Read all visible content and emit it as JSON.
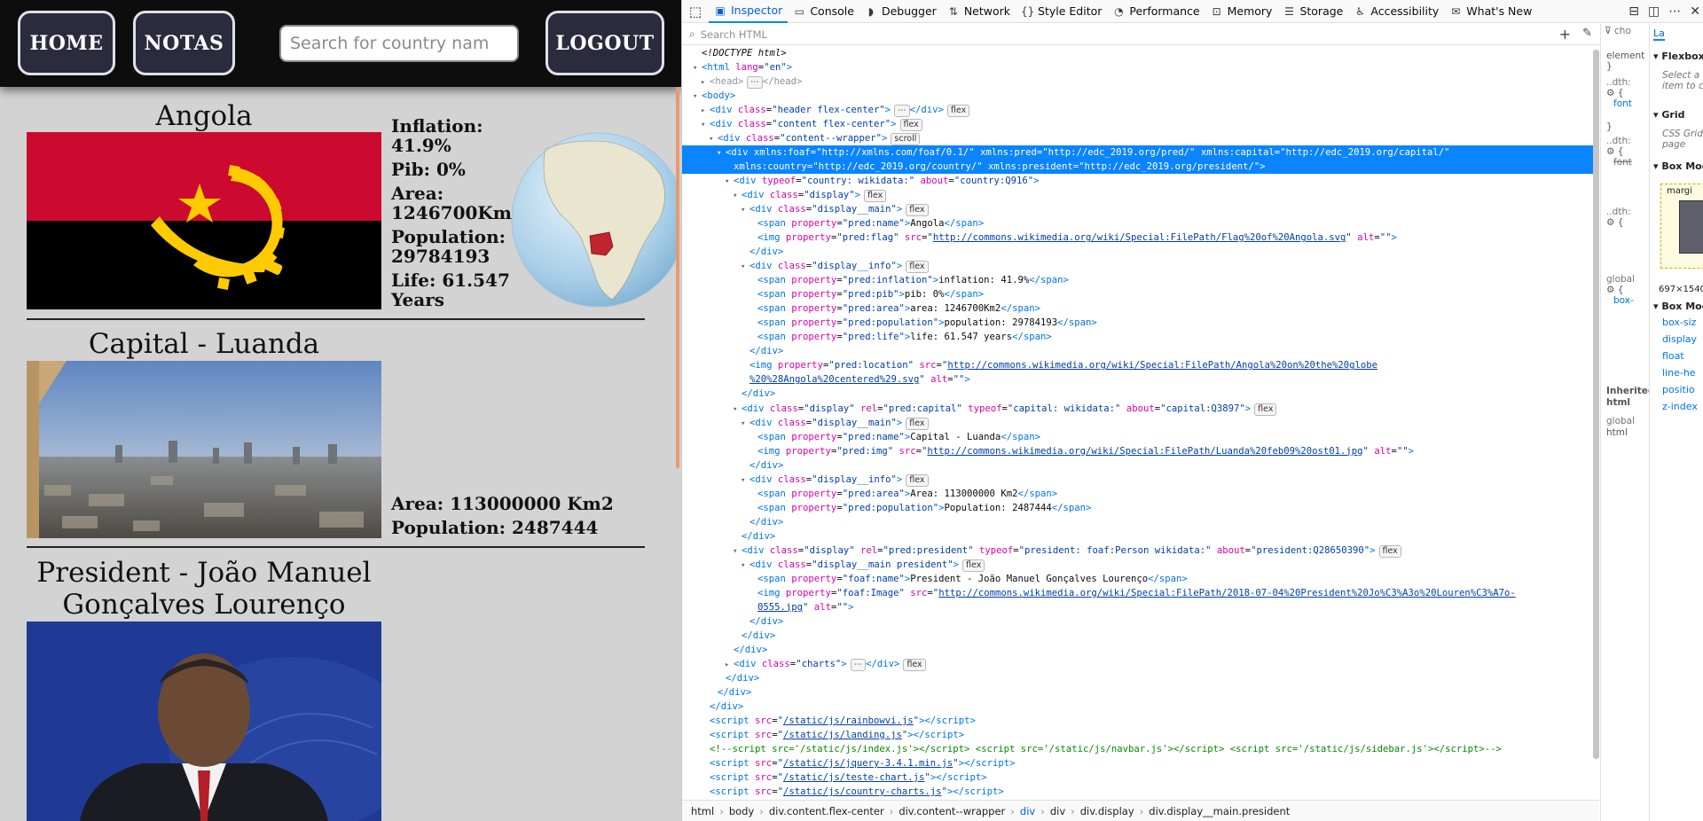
{
  "site": {
    "nav": {
      "home": "HOME",
      "notas": "NOTAS",
      "logout": "LOGOUT",
      "search_placeholder": "Search for country nam"
    },
    "country": {
      "name": "Angola",
      "inflation": "Inflation:",
      "inflation_value": "41.9%",
      "pib": "Pib: 0%",
      "area": "Area:",
      "area_value": "1246700Km2",
      "population": "Population:",
      "population_value": "29784193",
      "life": "Life: 61.547",
      "life_unit": "Years"
    },
    "capital": {
      "name": "Capital - Luanda",
      "area": "Area: 113000000 Km2",
      "population": "Population: 2487444"
    },
    "president": {
      "name_line1": "President - João Manuel",
      "name_line2": "Gonçalves Lourenço"
    }
  },
  "devtools": {
    "tabs": [
      {
        "label": "Inspector",
        "icon": "inspector-icon"
      },
      {
        "label": "Console",
        "icon": "console-icon"
      },
      {
        "label": "Debugger",
        "icon": "debugger-icon"
      },
      {
        "label": "Network",
        "icon": "network-icon"
      },
      {
        "label": "Style Editor",
        "icon": "style-editor-icon"
      },
      {
        "label": "Performance",
        "icon": "performance-icon"
      },
      {
        "label": "Memory",
        "icon": "memory-icon"
      },
      {
        "label": "Storage",
        "icon": "storage-icon"
      },
      {
        "label": "Accessibility",
        "icon": "accessibility-icon"
      },
      {
        "label": "What's New",
        "icon": "whats-new-icon"
      }
    ],
    "search_placeholder": "Search HTML",
    "breadcrumbs": [
      "html",
      "body",
      "div.content.flex-center",
      "div.content--wrapper",
      "div",
      "div",
      "div.display",
      "div.display__main.president"
    ],
    "rules_panel": {
      "filter_text": "cho",
      "element_label": "element",
      "brace": "}",
      "dth_label": "..dth:",
      "font_label": "font",
      "global_label": "global",
      "box_label": "box-",
      "inherited": "Inherited",
      "inherited_from": "html",
      "html_label": "html"
    },
    "layout_panel": {
      "tab": "La",
      "flexbox": "Flexbox",
      "flexbox_hint": "Select a",
      "flexbox_hint2": "item to c",
      "grid": "Grid",
      "grid_hint": "CSS Grid",
      "grid_hint2": "page",
      "box_model": "Box Moc",
      "margin": "margi",
      "dims": "697×1540",
      "box_model_props": "Box Moc",
      "props": [
        "box-siz",
        "display",
        "float",
        "line-he",
        "positio",
        "z-index"
      ]
    },
    "code_lines": [
      {
        "indent": 0,
        "html": "<span class=\"cm\" style=\"color:#0c0c0d;font-style:italic\">&lt;!DOCTYPE html&gt;</span>"
      },
      {
        "indent": 0,
        "arrow": "▾",
        "html": "<span class=\"tg\">&lt;html</span> <span class=\"at\">lang</span>=<span class=\"av\">\"en\"</span><span class=\"tg\">&gt;</span>"
      },
      {
        "indent": 1,
        "arrow": "▸",
        "html": "<span class=\"tg\" style=\"color:#8f8f9d\">&lt;head&gt;</span><span class=\"badge\">⋯</span><span class=\"tg\" style=\"color:#8f8f9d\">&lt;/head&gt;</span>"
      },
      {
        "indent": 0,
        "arrow": "▾",
        "html": "<span class=\"tg\">&lt;body&gt;</span>"
      },
      {
        "indent": 1,
        "arrow": "▸",
        "html": "<span class=\"tg\">&lt;div</span> <span class=\"at\">class</span>=<span class=\"av\">\"header flex-center\"</span><span class=\"tg\">&gt;</span><span class=\"badge\">⋯</span><span class=\"tg\">&lt;/div&gt;</span><span class=\"badge\">flex</span>"
      },
      {
        "indent": 1,
        "arrow": "▾",
        "html": "<span class=\"tg\">&lt;div</span> <span class=\"at\">class</span>=<span class=\"av\">\"content flex-center\"</span><span class=\"tg\">&gt;</span><span class=\"badge\">flex</span>"
      },
      {
        "indent": 2,
        "arrow": "▾",
        "html": "<span class=\"tg\">&lt;div</span> <span class=\"at\">class</span>=<span class=\"av\">\"content--wrapper\"</span><span class=\"tg\">&gt;</span><span class=\"badge\">scroll</span>"
      },
      {
        "indent": 3,
        "arrow": "▾",
        "selected": true,
        "html": "<span class=\"tg\">&lt;div</span> <span class=\"at\">xmlns:foaf</span>=<span class=\"av\">\"http://xmlns.com/foaf/0.1/\"</span> <span class=\"at\">xmlns:pred</span>=<span class=\"av\">\"http://edc_2019.org/pred/\"</span> <span class=\"at\">xmlns:capital</span>=<span class=\"av\">\"http://edc_2019.org/capital/\"</span>"
      },
      {
        "indent": 4,
        "selected": true,
        "html": "<span class=\"at\">xmlns:country</span>=<span class=\"av\">\"http://edc_2019.org/country/\"</span> <span class=\"at\">xmlns:president</span>=<span class=\"av\">\"http://edc_2019.org/president/\"</span><span class=\"tg\">&gt;</span>"
      },
      {
        "indent": 4,
        "arrow": "▾",
        "html": "<span class=\"tg\">&lt;div</span> <span class=\"at\">typeof</span>=<span class=\"av\">\"country: wikidata:\"</span> <span class=\"at\">about</span>=<span class=\"av\">\"country:Q916\"</span><span class=\"tg\">&gt;</span>"
      },
      {
        "indent": 5,
        "arrow": "▾",
        "html": "<span class=\"tg\">&lt;div</span> <span class=\"at\">class</span>=<span class=\"av\">\"display\"</span><span class=\"tg\">&gt;</span><span class=\"badge\">flex</span>"
      },
      {
        "indent": 6,
        "arrow": "▾",
        "html": "<span class=\"tg\">&lt;div</span> <span class=\"at\">class</span>=<span class=\"av\">\"display__main\"</span><span class=\"tg\">&gt;</span><span class=\"badge\">flex</span>"
      },
      {
        "indent": 7,
        "html": "<span class=\"tg\">&lt;span</span> <span class=\"at\">property</span>=<span class=\"av\">\"pred:name\"</span><span class=\"tg\">&gt;</span>Angola<span class=\"tg\">&lt;/span&gt;</span>"
      },
      {
        "indent": 7,
        "html": "<span class=\"tg\">&lt;img</span> <span class=\"at\">property</span>=<span class=\"av\">\"pred:flag\"</span> <span class=\"at\">src</span>=<span class=\"av\">\"</span><span class=\"lk\">http://commons.wikimedia.org/wiki/Special:FilePath/Flag%20of%20Angola.svg</span><span class=\"av\">\"</span> <span class=\"at\">alt</span>=<span class=\"av\">\"\"</span><span class=\"tg\">&gt;</span>"
      },
      {
        "indent": 6,
        "html": "<span class=\"tg\">&lt;/div&gt;</span>"
      },
      {
        "indent": 6,
        "arrow": "▾",
        "html": "<span class=\"tg\">&lt;div</span> <span class=\"at\">class</span>=<span class=\"av\">\"display__info\"</span><span class=\"tg\">&gt;</span><span class=\"badge\">flex</span>"
      },
      {
        "indent": 7,
        "html": "<span class=\"tg\">&lt;span</span> <span class=\"at\">property</span>=<span class=\"av\">\"pred:inflation\"</span><span class=\"tg\">&gt;</span>inflation: 41.9%<span class=\"tg\">&lt;/span&gt;</span>"
      },
      {
        "indent": 7,
        "html": "<span class=\"tg\">&lt;span</span> <span class=\"at\">property</span>=<span class=\"av\">\"pred:pib\"</span><span class=\"tg\">&gt;</span>pib: 0%<span class=\"tg\">&lt;/span&gt;</span>"
      },
      {
        "indent": 7,
        "html": "<span class=\"tg\">&lt;span</span> <span class=\"at\">property</span>=<span class=\"av\">\"pred:area\"</span><span class=\"tg\">&gt;</span>area: 1246700Km2<span class=\"tg\">&lt;/span&gt;</span>"
      },
      {
        "indent": 7,
        "html": "<span class=\"tg\">&lt;span</span> <span class=\"at\">property</span>=<span class=\"av\">\"pred:population\"</span><span class=\"tg\">&gt;</span>population: 29784193<span class=\"tg\">&lt;/span&gt;</span>"
      },
      {
        "indent": 7,
        "html": "<span class=\"tg\">&lt;span</span> <span class=\"at\">property</span>=<span class=\"av\">\"pred:life\"</span><span class=\"tg\">&gt;</span>life: 61.547 years<span class=\"tg\">&lt;/span&gt;</span>"
      },
      {
        "indent": 6,
        "html": "<span class=\"tg\">&lt;/div&gt;</span>"
      },
      {
        "indent": 6,
        "html": "<span class=\"tg\">&lt;img</span> <span class=\"at\">property</span>=<span class=\"av\">\"pred:location\"</span> <span class=\"at\">src</span>=<span class=\"av\">\"</span><span class=\"lk\">http://commons.wikimedia.org/wiki/Special:FilePath/Angola%20on%20the%20globe</span>"
      },
      {
        "indent": 6,
        "html": "<span class=\"lk\">%20%28Angola%20centered%29.svg</span><span class=\"av\">\"</span> <span class=\"at\">alt</span>=<span class=\"av\">\"\"</span><span class=\"tg\">&gt;</span>"
      },
      {
        "indent": 5,
        "html": "<span class=\"tg\">&lt;/div&gt;</span>"
      },
      {
        "indent": 5,
        "arrow": "▾",
        "html": "<span class=\"tg\">&lt;div</span> <span class=\"at\">class</span>=<span class=\"av\">\"display\"</span> <span class=\"at\">rel</span>=<span class=\"av\">\"pred:capital\"</span> <span class=\"at\">typeof</span>=<span class=\"av\">\"capital: wikidata:\"</span> <span class=\"at\">about</span>=<span class=\"av\">\"capital:Q3897\"</span><span class=\"tg\">&gt;</span><span class=\"badge\">flex</span>"
      },
      {
        "indent": 6,
        "arrow": "▾",
        "html": "<span class=\"tg\">&lt;div</span> <span class=\"at\">class</span>=<span class=\"av\">\"display__main\"</span><span class=\"tg\">&gt;</span><span class=\"badge\">flex</span>"
      },
      {
        "indent": 7,
        "html": "<span class=\"tg\">&lt;span</span> <span class=\"at\">property</span>=<span class=\"av\">\"pred:name\"</span><span class=\"tg\">&gt;</span>Capital - Luanda<span class=\"tg\">&lt;/span&gt;</span>"
      },
      {
        "indent": 7,
        "html": "<span class=\"tg\">&lt;img</span> <span class=\"at\">property</span>=<span class=\"av\">\"pred:img\"</span> <span class=\"at\">src</span>=<span class=\"av\">\"</span><span class=\"lk\">http://commons.wikimedia.org/wiki/Special:FilePath/Luanda%20feb09%20ost01.jpg</span><span class=\"av\">\"</span> <span class=\"at\">alt</span>=<span class=\"av\">\"\"</span><span class=\"tg\">&gt;</span>"
      },
      {
        "indent": 6,
        "html": "<span class=\"tg\">&lt;/div&gt;</span>"
      },
      {
        "indent": 6,
        "arrow": "▾",
        "html": "<span class=\"tg\">&lt;div</span> <span class=\"at\">class</span>=<span class=\"av\">\"display__info\"</span><span class=\"tg\">&gt;</span><span class=\"badge\">flex</span>"
      },
      {
        "indent": 7,
        "html": "<span class=\"tg\">&lt;span</span> <span class=\"at\">property</span>=<span class=\"av\">\"pred:area\"</span><span class=\"tg\">&gt;</span>Area: 113000000 Km2<span class=\"tg\">&lt;/span&gt;</span>"
      },
      {
        "indent": 7,
        "html": "<span class=\"tg\">&lt;span</span> <span class=\"at\">property</span>=<span class=\"av\">\"pred:population\"</span><span class=\"tg\">&gt;</span>Population: 2487444<span class=\"tg\">&lt;/span&gt;</span>"
      },
      {
        "indent": 6,
        "html": "<span class=\"tg\">&lt;/div&gt;</span>"
      },
      {
        "indent": 5,
        "html": "<span class=\"tg\">&lt;/div&gt;</span>"
      },
      {
        "indent": 5,
        "arrow": "▾",
        "html": "<span class=\"tg\">&lt;div</span> <span class=\"at\">class</span>=<span class=\"av\">\"display\"</span> <span class=\"at\">rel</span>=<span class=\"av\">\"pred:president\"</span> <span class=\"at\">typeof</span>=<span class=\"av\">\"president: foaf:Person wikidata:\"</span> <span class=\"at\">about</span>=<span class=\"av\">\"president:Q28650390\"</span><span class=\"tg\">&gt;</span><span class=\"badge\">flex</span>"
      },
      {
        "indent": 6,
        "arrow": "▾",
        "html": "<span class=\"tg\">&lt;div</span> <span class=\"at\">class</span>=<span class=\"av\">\"display__main president\"</span><span class=\"tg\">&gt;</span><span class=\"badge\">flex</span>"
      },
      {
        "indent": 7,
        "html": "<span class=\"tg\">&lt;span</span> <span class=\"at\">property</span>=<span class=\"av\">\"foaf:name\"</span><span class=\"tg\">&gt;</span>President - João Manuel Gonçalves Lourenço<span class=\"tg\">&lt;/span&gt;</span>"
      },
      {
        "indent": 7,
        "html": "<span class=\"tg\">&lt;img</span> <span class=\"at\">property</span>=<span class=\"av\">\"foaf:Image\"</span> <span class=\"at\">src</span>=<span class=\"av\">\"</span><span class=\"lk\">http://commons.wikimedia.org/wiki/Special:FilePath/2018-07-04%20President%20Jo%C3%A3o%20Louren%C3%A7o-</span>"
      },
      {
        "indent": 7,
        "html": "<span class=\"lk\">0555.jpg</span><span class=\"av\">\"</span> <span class=\"at\">alt</span>=<span class=\"av\">\"\"</span><span class=\"tg\">&gt;</span>"
      },
      {
        "indent": 6,
        "html": "<span class=\"tg\">&lt;/div&gt;</span>"
      },
      {
        "indent": 5,
        "html": "<span class=\"tg\">&lt;/div&gt;</span>"
      },
      {
        "indent": 4,
        "html": "<span class=\"tg\">&lt;/div&gt;</span>"
      },
      {
        "indent": 4,
        "arrow": "▸",
        "html": "<span class=\"tg\">&lt;div</span> <span class=\"at\">class</span>=<span class=\"av\">\"charts\"</span><span class=\"tg\">&gt;</span><span class=\"badge\">⋯</span><span class=\"tg\">&lt;/div&gt;</span><span class=\"badge\">flex</span>"
      },
      {
        "indent": 3,
        "html": "<span class=\"tg\">&lt;/div&gt;</span>"
      },
      {
        "indent": 2,
        "html": "<span class=\"tg\">&lt;/div&gt;</span>"
      },
      {
        "indent": 1,
        "html": "<span class=\"tg\">&lt;/div&gt;</span>"
      },
      {
        "indent": 1,
        "html": "<span class=\"tg\">&lt;script</span> <span class=\"at\">src</span>=<span class=\"av\">\"</span><span class=\"lk\">/static/js/rainbowvi.js</span><span class=\"av\">\"</span><span class=\"tg\">&gt;&lt;/script&gt;</span>"
      },
      {
        "indent": 1,
        "html": "<span class=\"tg\">&lt;script</span> <span class=\"at\">src</span>=<span class=\"av\">\"</span><span class=\"lk\">/static/js/landing.js</span><span class=\"av\">\"</span><span class=\"tg\">&gt;&lt;/script&gt;</span>"
      },
      {
        "indent": 1,
        "html": "<span class=\"cm\">&lt;!--script src='/static/js/index.js'&gt;&lt;/script&gt; &lt;script src='/static/js/navbar.js'&gt;&lt;/script&gt; &lt;script src='/static/js/sidebar.js'&gt;&lt;/script&gt;--&gt;</span>"
      },
      {
        "indent": 1,
        "html": "<span class=\"tg\">&lt;script</span> <span class=\"at\">src</span>=<span class=\"av\">\"</span><span class=\"lk\">/static/js/jquery-3.4.1.min.js</span><span class=\"av\">\"</span><span class=\"tg\">&gt;&lt;/script&gt;</span>"
      },
      {
        "indent": 1,
        "html": "<span class=\"tg\">&lt;script</span> <span class=\"at\">src</span>=<span class=\"av\">\"</span><span class=\"lk\">/static/js/teste-chart.js</span><span class=\"av\">\"</span><span class=\"tg\">&gt;&lt;/script&gt;</span>"
      },
      {
        "indent": 1,
        "html": "<span class=\"tg\">&lt;script</span> <span class=\"at\">src</span>=<span class=\"av\">\"</span><span class=\"lk\">/static/js/country-charts.js</span><span class=\"av\">\"</span><span class=\"tg\">&gt;&lt;/script&gt;</span>"
      }
    ]
  }
}
